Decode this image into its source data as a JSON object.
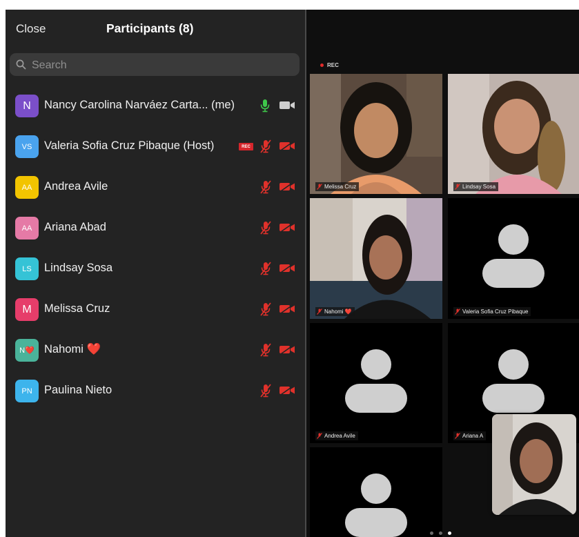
{
  "panel": {
    "close_label": "Close",
    "title": "Participants (8)",
    "search_placeholder": "Search"
  },
  "participants": [
    {
      "initials": "N",
      "name": "Nancy Carolina Narváez Carta... (me)",
      "avatar_color": "#7b4fc9",
      "mic": "on",
      "camera": "off-grey"
    },
    {
      "initials": "VS",
      "name": "Valeria Sofia Cruz Pibaque (Host)",
      "avatar_color": "#4aa3ee",
      "mic": "off",
      "camera": "off",
      "badge": "REC"
    },
    {
      "initials": "AA",
      "name": "Andrea Avile",
      "avatar_color": "#f2c400",
      "mic": "off",
      "camera": "off"
    },
    {
      "initials": "AA",
      "name": "Ariana Abad",
      "avatar_color": "#e57aa6",
      "mic": "off",
      "camera": "off"
    },
    {
      "initials": "LS",
      "name": "Lindsay Sosa",
      "avatar_color": "#35c3d6",
      "mic": "off",
      "camera": "off"
    },
    {
      "initials": "M",
      "name": "Melissa Cruz",
      "avatar_color": "#e63d6a",
      "mic": "off",
      "camera": "off"
    },
    {
      "initials": "N❤️",
      "name": "Nahomi ❤️",
      "avatar_color": "#4ab39a",
      "mic": "off",
      "camera": "off"
    },
    {
      "initials": "PN",
      "name": "Paulina Nieto",
      "avatar_color": "#3db4ec",
      "mic": "off",
      "camera": "off"
    }
  ],
  "grid": {
    "rec_label": "REC",
    "tiles": [
      {
        "label": "Melissa Cruz",
        "kind": "video",
        "active": true
      },
      {
        "label": "Lindsay Sosa",
        "kind": "video",
        "active": false
      },
      {
        "label": "Nahomi ❤️",
        "kind": "video",
        "active": false
      },
      {
        "label": "Valeria Sofia Cruz Pibaque",
        "kind": "avatar",
        "active": false
      },
      {
        "label": "Andrea Avile",
        "kind": "avatar",
        "active": false
      },
      {
        "label": "Ariana A",
        "kind": "avatar",
        "active": false
      },
      {
        "label": "",
        "kind": "avatar",
        "active": false
      }
    ],
    "page_count": 3,
    "current_page": 3
  },
  "colors": {
    "panel_bg": "#232323",
    "mic_on": "#3ec84a",
    "muted": "#e0312b",
    "active_speaker": "#27c93f"
  }
}
